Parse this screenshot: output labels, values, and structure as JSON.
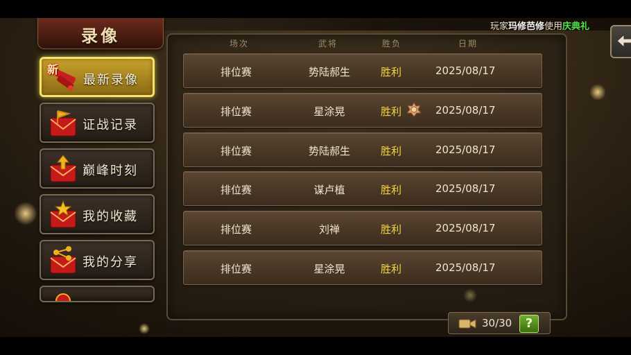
{
  "ticker": {
    "prefix": "玩家",
    "player_name": "玛修芭修",
    "verb": "使用",
    "item_name": "庆典礼"
  },
  "title": "录像",
  "sidebar": {
    "items": [
      {
        "label": "最新录像",
        "badge": "新",
        "active": true
      },
      {
        "label": "证战记录",
        "active": false
      },
      {
        "label": "巅峰时刻",
        "active": false
      },
      {
        "label": "我的收藏",
        "active": false
      },
      {
        "label": "我的分享",
        "active": false
      },
      {
        "label": "",
        "active": false
      }
    ]
  },
  "table": {
    "headers": [
      "场次",
      "武将",
      "胜负",
      "日期"
    ],
    "rows": [
      {
        "type": "排位赛",
        "general": "势陆郝生",
        "result": "胜利",
        "date": "2025/08/17",
        "medal": false
      },
      {
        "type": "排位赛",
        "general": "星涂晃",
        "result": "胜利",
        "date": "2025/08/17",
        "medal": true
      },
      {
        "type": "排位赛",
        "general": "势陆郝生",
        "result": "胜利",
        "date": "2025/08/17",
        "medal": false
      },
      {
        "type": "排位赛",
        "general": "谋卢植",
        "result": "胜利",
        "date": "2025/08/17",
        "medal": false
      },
      {
        "type": "排位赛",
        "general": "刘禅",
        "result": "胜利",
        "date": "2025/08/17",
        "medal": false
      },
      {
        "type": "排位赛",
        "general": "星涂晃",
        "result": "胜利",
        "date": "2025/08/17",
        "medal": false
      }
    ]
  },
  "footer": {
    "count": "30/30",
    "help_label": "?"
  },
  "colors": {
    "result": "#f2d640",
    "active_border": "#f5e36a",
    "ticker_item": "#4fe34f"
  }
}
